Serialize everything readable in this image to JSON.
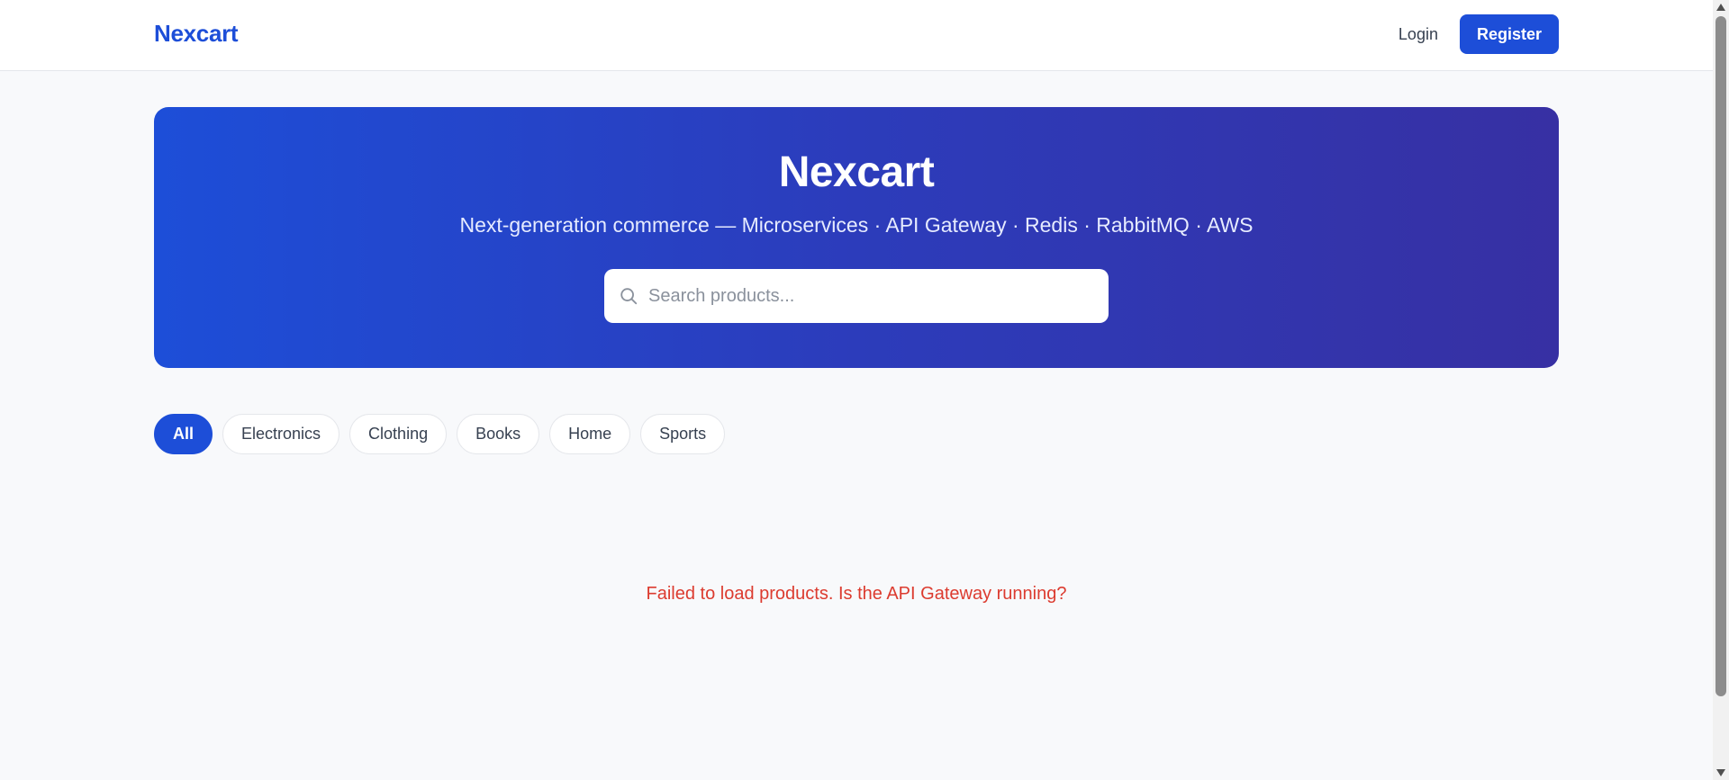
{
  "navbar": {
    "brand": "Nexcart",
    "login_label": "Login",
    "register_label": "Register"
  },
  "hero": {
    "title": "Nexcart",
    "subtitle": "Next-generation commerce — Microservices · API Gateway · Redis · RabbitMQ · AWS",
    "search": {
      "placeholder": "Search products...",
      "value": "",
      "icon": "search-icon"
    }
  },
  "filters": {
    "active": "All",
    "items": [
      {
        "label": "All"
      },
      {
        "label": "Electronics"
      },
      {
        "label": "Clothing"
      },
      {
        "label": "Books"
      },
      {
        "label": "Home"
      },
      {
        "label": "Sports"
      }
    ]
  },
  "status": {
    "error": "Failed to load products. Is the API Gateway running?"
  },
  "colors": {
    "brand": "#1d4ed8",
    "hero_gradient_start": "#1d4ed8",
    "hero_gradient_end": "#3730a3",
    "error": "#dc3b2f",
    "page_background": "#f8f9fb"
  }
}
